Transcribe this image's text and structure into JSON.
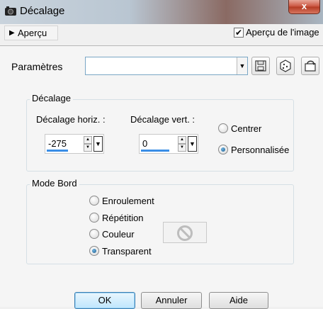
{
  "window": {
    "title": "Décalage",
    "close_label": "x"
  },
  "preview": {
    "toggle_label": "Aperçu",
    "image_preview_label": "Aperçu de l'image",
    "image_preview_checked": true
  },
  "presets": {
    "label": "Paramètres",
    "value": ""
  },
  "offset_group": {
    "title": "Décalage",
    "horizontal_label": "Décalage horiz. :",
    "horizontal_value": "-275",
    "vertical_label": "Décalage vert. :",
    "vertical_value": "0",
    "options": [
      {
        "label": "Centrer",
        "selected": false
      },
      {
        "label": "Personnalisée",
        "selected": true
      }
    ]
  },
  "edge_group": {
    "title": "Mode Bord",
    "options": [
      {
        "label": "Enroulement",
        "selected": false
      },
      {
        "label": "Répétition",
        "selected": false
      },
      {
        "label": "Couleur",
        "selected": false
      },
      {
        "label": "Transparent",
        "selected": true
      }
    ],
    "color_swatch_icon": "no-color-icon"
  },
  "buttons": {
    "ok": "OK",
    "cancel": "Annuler",
    "help": "Aide"
  },
  "colors": {
    "accent": "#3a8ee6",
    "radio_selected": "#1f5f8f",
    "close": "#c9513c"
  }
}
